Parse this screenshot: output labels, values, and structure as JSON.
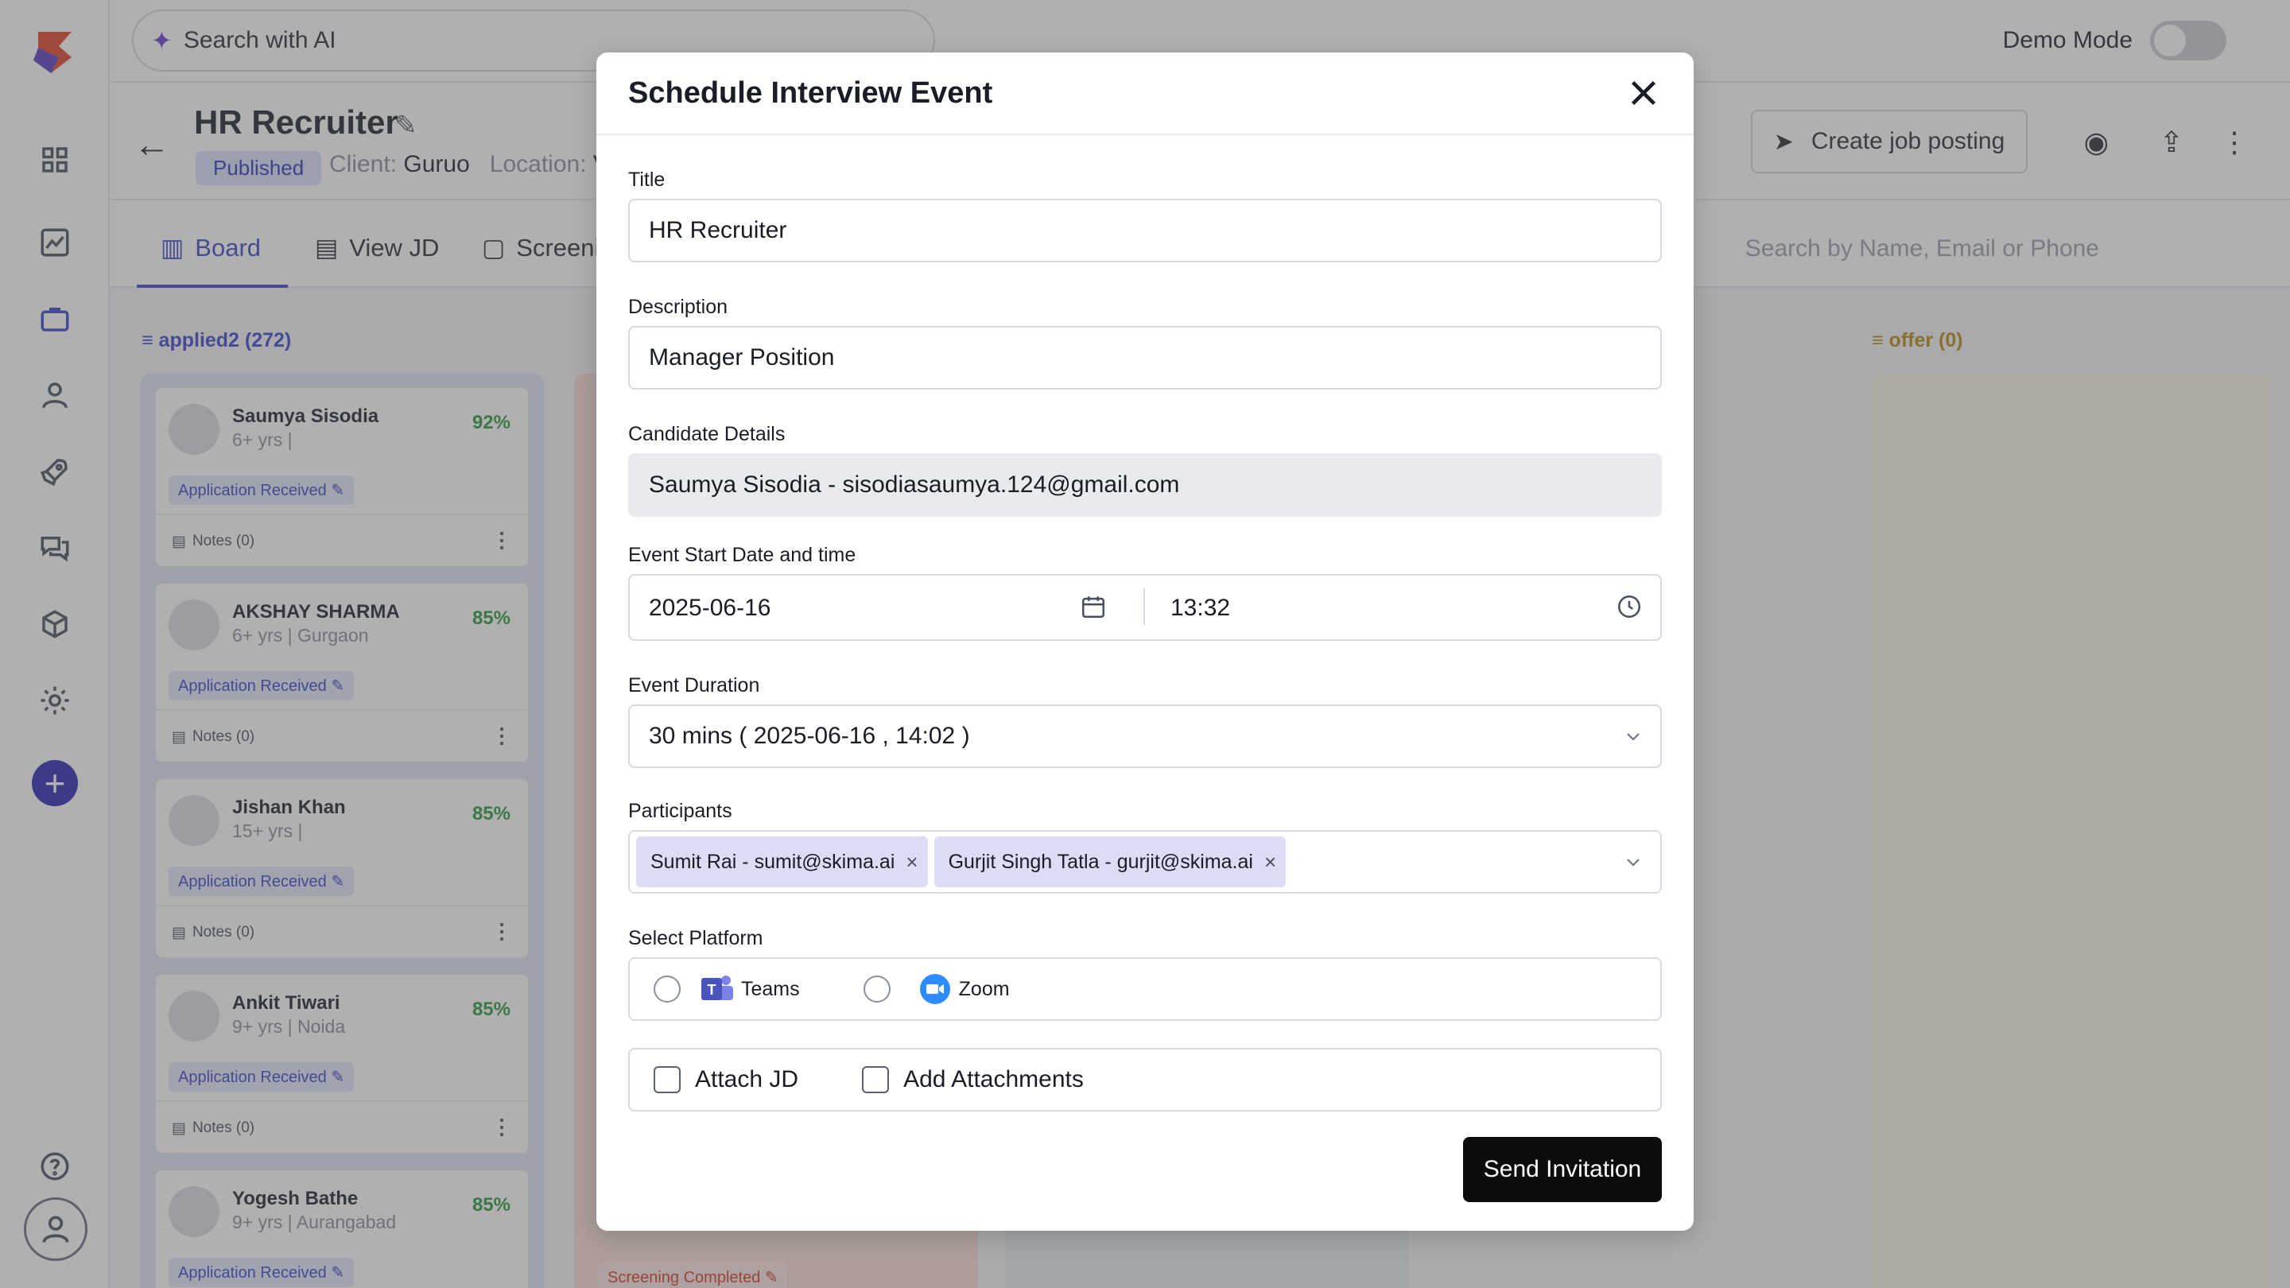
{
  "top": {
    "ai_search_label": "Search with AI",
    "demo_label": "Demo Mode"
  },
  "job": {
    "title": "HR Recruiter",
    "status": "Published",
    "client_label": "Client:",
    "client": "Guruo",
    "location_label": "Location:",
    "location": "V",
    "create_posting": "Create job posting"
  },
  "tabs": [
    {
      "label": "Board"
    },
    {
      "label": "View JD"
    },
    {
      "label": "Screeni"
    }
  ],
  "candidate_search_placeholder": "Search by Name, Email or Phone",
  "columns": [
    {
      "title": "applied2 (272)",
      "color": "#3b47c9"
    },
    {
      "title": "offer (0)",
      "color": "#b78a12"
    }
  ],
  "cards": [
    {
      "name": "Saumya Sisodia",
      "exp": "6+ yrs",
      "loc": "",
      "score": "92%",
      "status": "Application Received",
      "notes": "Notes (0)"
    },
    {
      "name": "AKSHAY SHARMA",
      "exp": "6+ yrs",
      "loc": "Gurgaon",
      "score": "85%",
      "status": "Application Received",
      "notes": "Notes (0)"
    },
    {
      "name": "Jishan Khan",
      "exp": "15+ yrs",
      "loc": "",
      "score": "85%",
      "status": "Application Received",
      "notes": "Notes (0)"
    },
    {
      "name": "Ankit Tiwari",
      "exp": "9+ yrs",
      "loc": "Noida",
      "score": "85%",
      "status": "Application Received",
      "notes": "Notes (0)"
    },
    {
      "name": "Yogesh Bathe",
      "exp": "9+ yrs",
      "loc": "Aurangabad",
      "score": "85%",
      "status": "Application Received",
      "notes": ""
    }
  ],
  "screening_badge": "Screening Completed",
  "modal": {
    "title": "Schedule Interview Event",
    "title_label": "Title",
    "title_value": "HR Recruiter",
    "description_label": "Description",
    "description_value": "Manager Position",
    "candidate_label": "Candidate Details",
    "candidate_value": "Saumya Sisodia - sisodiasaumya.124@gmail.com",
    "start_label": "Event Start Date and time",
    "start_date": "2025-06-16",
    "start_time": "13:32",
    "duration_label": "Event Duration",
    "duration_value": "30 mins ( 2025-06-16 , 14:02 )",
    "participants_label": "Participants",
    "participants": [
      "Sumit Rai - sumit@skima.ai",
      "Gurjit Singh Tatla - gurjit@skima.ai"
    ],
    "platform_label": "Select Platform",
    "platforms": [
      "Teams",
      "Zoom"
    ],
    "attach_jd": "Attach JD",
    "add_attachments": "Add Attachments",
    "send": "Send Invitation"
  }
}
